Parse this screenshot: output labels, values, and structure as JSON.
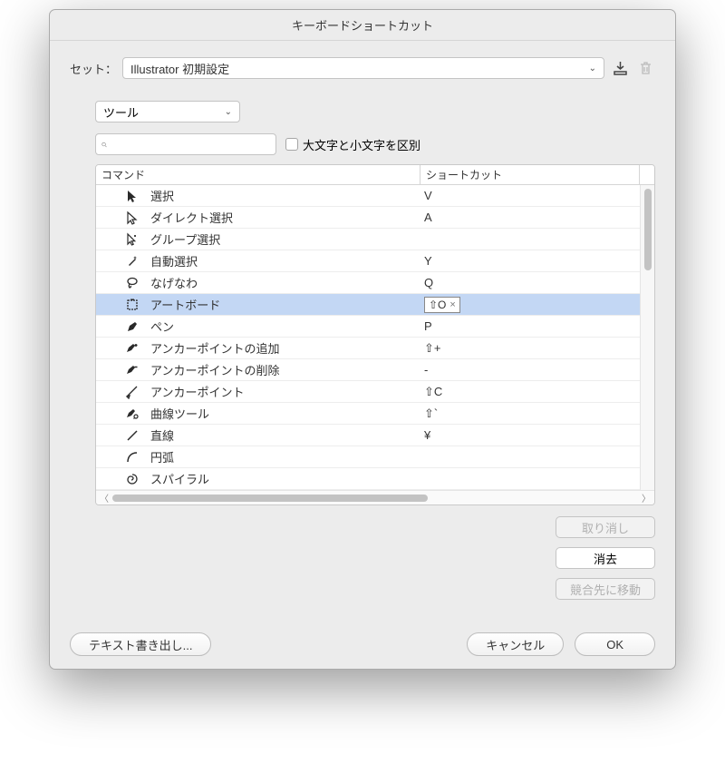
{
  "window": {
    "title": "キーボードショートカット"
  },
  "set": {
    "label": "セット：",
    "value": "Illustrator 初期設定"
  },
  "type": {
    "value": "ツール"
  },
  "search": {
    "placeholder": ""
  },
  "case_sensitive": {
    "label": "大文字と小文字を区別"
  },
  "table": {
    "header_command": "コマンド",
    "header_shortcut": "ショートカット",
    "rows": [
      {
        "icon": "selection",
        "name": "選択",
        "shortcut": "V",
        "selected": false
      },
      {
        "icon": "direct-selection",
        "name": "ダイレクト選択",
        "shortcut": "A",
        "selected": false
      },
      {
        "icon": "group-selection",
        "name": "グループ選択",
        "shortcut": "",
        "selected": false
      },
      {
        "icon": "magic-wand",
        "name": "自動選択",
        "shortcut": "Y",
        "selected": false
      },
      {
        "icon": "lasso",
        "name": "なげなわ",
        "shortcut": "Q",
        "selected": false
      },
      {
        "icon": "artboard",
        "name": "アートボード",
        "shortcut": "⇧O",
        "selected": true,
        "editing": true
      },
      {
        "icon": "pen",
        "name": "ペン",
        "shortcut": "P",
        "selected": false
      },
      {
        "icon": "add-anchor",
        "name": "アンカーポイントの追加",
        "shortcut": "⇧+",
        "selected": false
      },
      {
        "icon": "delete-anchor",
        "name": "アンカーポイントの削除",
        "shortcut": "-",
        "selected": false
      },
      {
        "icon": "anchor-point",
        "name": "アンカーポイント",
        "shortcut": "⇧C",
        "selected": false
      },
      {
        "icon": "curvature",
        "name": "曲線ツール",
        "shortcut": "⇧`",
        "selected": false
      },
      {
        "icon": "line",
        "name": "直線",
        "shortcut": "¥",
        "selected": false
      },
      {
        "icon": "arc",
        "name": "円弧",
        "shortcut": "",
        "selected": false
      },
      {
        "icon": "spiral",
        "name": "スパイラル",
        "shortcut": "",
        "selected": false
      }
    ]
  },
  "buttons": {
    "undo": "取り消し",
    "clear": "消去",
    "goto_conflict": "競合先に移動",
    "export": "テキスト書き出し...",
    "cancel": "キャンセル",
    "ok": "OK"
  }
}
